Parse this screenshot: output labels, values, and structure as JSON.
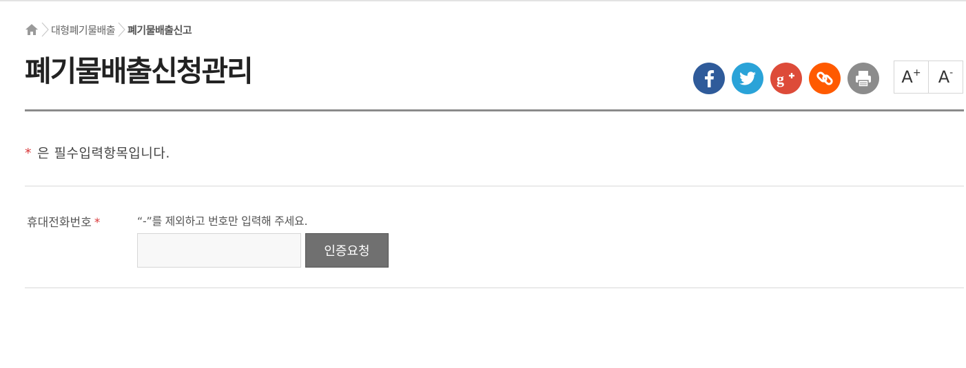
{
  "breadcrumb": {
    "home_icon": "home-icon",
    "items": [
      "대형폐기물배출",
      "폐기물배출신고"
    ]
  },
  "page_title": "폐기물배출신청관리",
  "share": [
    {
      "name": "facebook",
      "icon": "facebook-icon",
      "color": "#3b5998"
    },
    {
      "name": "twitter",
      "icon": "twitter-icon",
      "color": "#2aa3d8"
    },
    {
      "name": "google-plus",
      "icon": "google-plus-icon",
      "color": "#dd4b39"
    },
    {
      "name": "copy-link",
      "icon": "link-icon",
      "color": "#ff5a00"
    },
    {
      "name": "print",
      "icon": "print-icon",
      "color": "#8c8c8c"
    }
  ],
  "font_size": {
    "increase_label": "A",
    "increase_sup": "+",
    "decrease_label": "A",
    "decrease_sup": "-"
  },
  "required_note": {
    "star": "*",
    "text": "은 필수입력항목입니다."
  },
  "form": {
    "phone_label": "휴대전화번호",
    "phone_required": "*",
    "phone_hint": "“-”를 제외하고 번호만 입력해 주세요.",
    "phone_value": "",
    "verify_button": "인증요청"
  }
}
